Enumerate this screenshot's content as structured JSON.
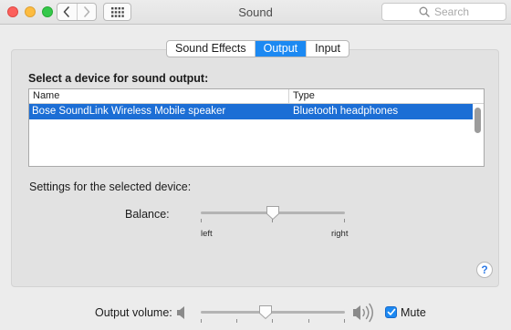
{
  "window": {
    "title": "Sound"
  },
  "toolbar": {
    "back_icon": "chevron-left-icon",
    "forward_icon": "chevron-right-icon",
    "show_all_icon": "grid-icon",
    "search_placeholder": "Search"
  },
  "tabs": [
    {
      "label": "Sound Effects",
      "selected": false
    },
    {
      "label": "Output",
      "selected": true
    },
    {
      "label": "Input",
      "selected": false
    }
  ],
  "output": {
    "heading": "Select a device for sound output:",
    "columns": {
      "name": "Name",
      "type": "Type"
    },
    "devices": [
      {
        "name": "Bose SoundLink Wireless Mobile speaker",
        "type": "Bluetooth headphones",
        "selected": true
      }
    ],
    "settings_heading": "Settings for the selected device:",
    "balance": {
      "label": "Balance:",
      "left_label": "left",
      "right_label": "right",
      "value": 0.5
    }
  },
  "help": {
    "label": "?"
  },
  "volume": {
    "label": "Output volume:",
    "value": 0.45,
    "mute_label": "Mute",
    "mute_checked": true
  },
  "colors": {
    "accent": "#1c89f2",
    "selection": "#1c6ed5",
    "close": "#fc605c",
    "minimize": "#fdbc40",
    "maximize": "#34c84a"
  }
}
